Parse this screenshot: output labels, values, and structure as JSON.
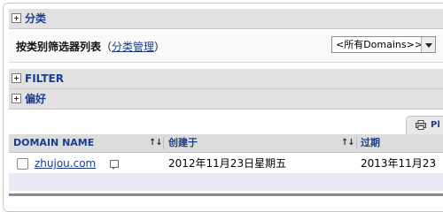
{
  "sections": {
    "category": {
      "title": "分类"
    },
    "filter": {
      "title": "FILTER"
    },
    "preferences": {
      "title": "偏好"
    }
  },
  "category_filter": {
    "label": "按类别筛选器列表",
    "paren_open": "（",
    "manage_link": "分类管理",
    "paren_close": "）",
    "select_value": "<所有Domains>>"
  },
  "print_tab": {
    "label": "Pl"
  },
  "table": {
    "columns": [
      {
        "label": "DOMAIN NAME"
      },
      {
        "label": "创建于"
      },
      {
        "label": "过期"
      }
    ],
    "sort_glyph": "↑↓",
    "rows": [
      {
        "domain": "zhujou.com",
        "created": "2012年11月23日星期五",
        "expires": "2013年11月23"
      }
    ]
  },
  "icons": [
    "expand-icon",
    "printer-icon",
    "sort-icon",
    "note-icon",
    "chevron-down-icon"
  ]
}
